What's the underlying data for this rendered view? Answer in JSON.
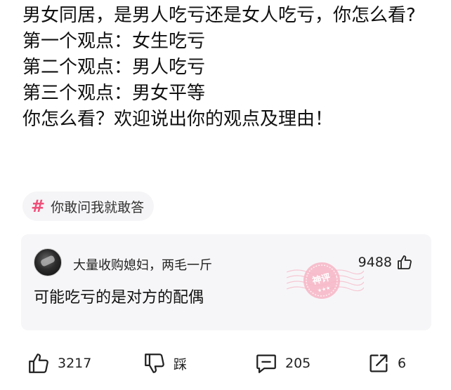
{
  "post": {
    "lines": [
      "男女同居，是男人吃亏还是女人吃亏，你怎么看?",
      "第一个观点：女生吃亏",
      "第二个观点：男人吃亏",
      "第三个观点：男女平等",
      "你怎么看？欢迎说出你的观点及理由！"
    ]
  },
  "topic": {
    "hash": "#",
    "label": "你敢问我就敢答"
  },
  "top_comment": {
    "username": "大量收购媳妇，两毛一斤",
    "likes": "9488",
    "text": "可能吃亏的是对方的配偶",
    "badge_text": "神评"
  },
  "actions": {
    "like_count": "3217",
    "dislike_label": "踩",
    "comment_count": "205",
    "share_count": "6"
  },
  "colors": {
    "accent_pink": "#f0507a",
    "stamp_pink": "#f6a9bd",
    "card_bg": "#f6f6f8"
  },
  "icons": [
    "thumbs-up-icon",
    "thumbs-down-icon",
    "comment-icon",
    "share-icon",
    "hash-icon"
  ]
}
